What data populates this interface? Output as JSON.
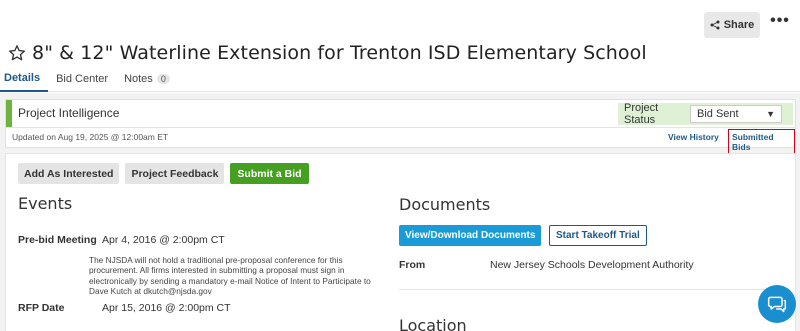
{
  "header": {
    "share_label": "Share",
    "more_label": "•••",
    "title": "8\" & 12\" Waterline Extension for Trenton ISD Elementary School"
  },
  "tabs": [
    {
      "label": "Details",
      "active": true
    },
    {
      "label": "Bid Center",
      "active": false
    },
    {
      "label": "Notes",
      "badge": "0",
      "active": false
    }
  ],
  "intelligence": {
    "title": "Project Intelligence",
    "status_label": "Project Status",
    "status_value": "Bid Sent",
    "updated": "Updated on Aug 19, 2025 @ 12:00am ET",
    "view_history": "View History",
    "submitted_bids": "Submitted Bids"
  },
  "actions": {
    "add_interested": "Add As Interested",
    "project_feedback": "Project Feedback",
    "submit_bid": "Submit a Bid"
  },
  "events": {
    "title": "Events",
    "prebid_label": "Pre-bid Meeting",
    "prebid_value": "Apr 4, 2016 @ 2:00pm CT",
    "prebid_note": "The NJSDA will not hold a traditional pre-proposal conference for this procurement. All firms interested in submitting a proposal must sign in electronically by sending a mandatory e-mail Notice of Intent to Participate to Dave Kutch at dkutch@njsda.gov",
    "rfp_label": "RFP Date",
    "rfp_value": "Apr 15, 2016 @ 2:00pm CT"
  },
  "documents": {
    "title": "Documents",
    "view_download": "View/Download Documents",
    "takeoff_trial": "Start Takeoff Trial",
    "from_label": "From",
    "from_value": "New Jersey Schools Development Authority"
  },
  "location": {
    "title": "Location"
  },
  "colors": {
    "accent_blue": "#1e5a89",
    "green": "#45a021",
    "status_bg": "#dff1d5",
    "highlight_red": "#d0021b"
  }
}
